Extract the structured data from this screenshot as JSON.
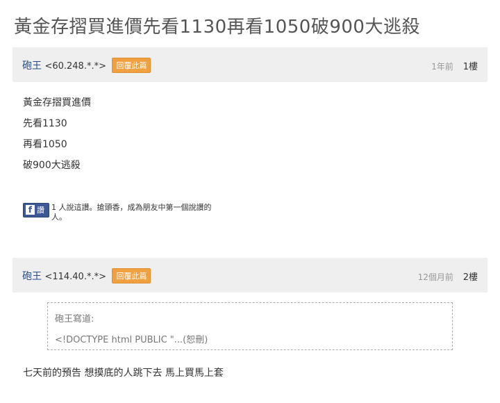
{
  "thread": {
    "title": "黃金存摺買進價先看1130再看1050破900大逃殺"
  },
  "posts": [
    {
      "author": "砲王",
      "ip": "<60.248.*.*>",
      "reply_label": "回覆此篇",
      "time": "1年前",
      "floor": "1樓",
      "lines": [
        "黃金存摺買進價",
        "先看1130",
        "再看1050",
        "破900大逃殺"
      ],
      "like": {
        "button_icon": "facebook-icon",
        "button_label": "讚",
        "text": "1 人說這讚。搶頭香，成為朋友中第一個說讚的人。"
      }
    },
    {
      "author": "砲王",
      "ip": "<114.40.*.*>",
      "reply_label": "回覆此篇",
      "time": "12個月前",
      "floor": "2樓",
      "quote": {
        "author_line": "砲王寫道:",
        "text": "<!DOCTYPE html PUBLIC \"...(恕刪)"
      },
      "text": "七天前的預告 想摸底的人跳下去 馬上買馬上套"
    }
  ],
  "colors": {
    "header_bg": "#efefef",
    "reply_btn": "#f0a040",
    "facebook": "#3b5998"
  }
}
